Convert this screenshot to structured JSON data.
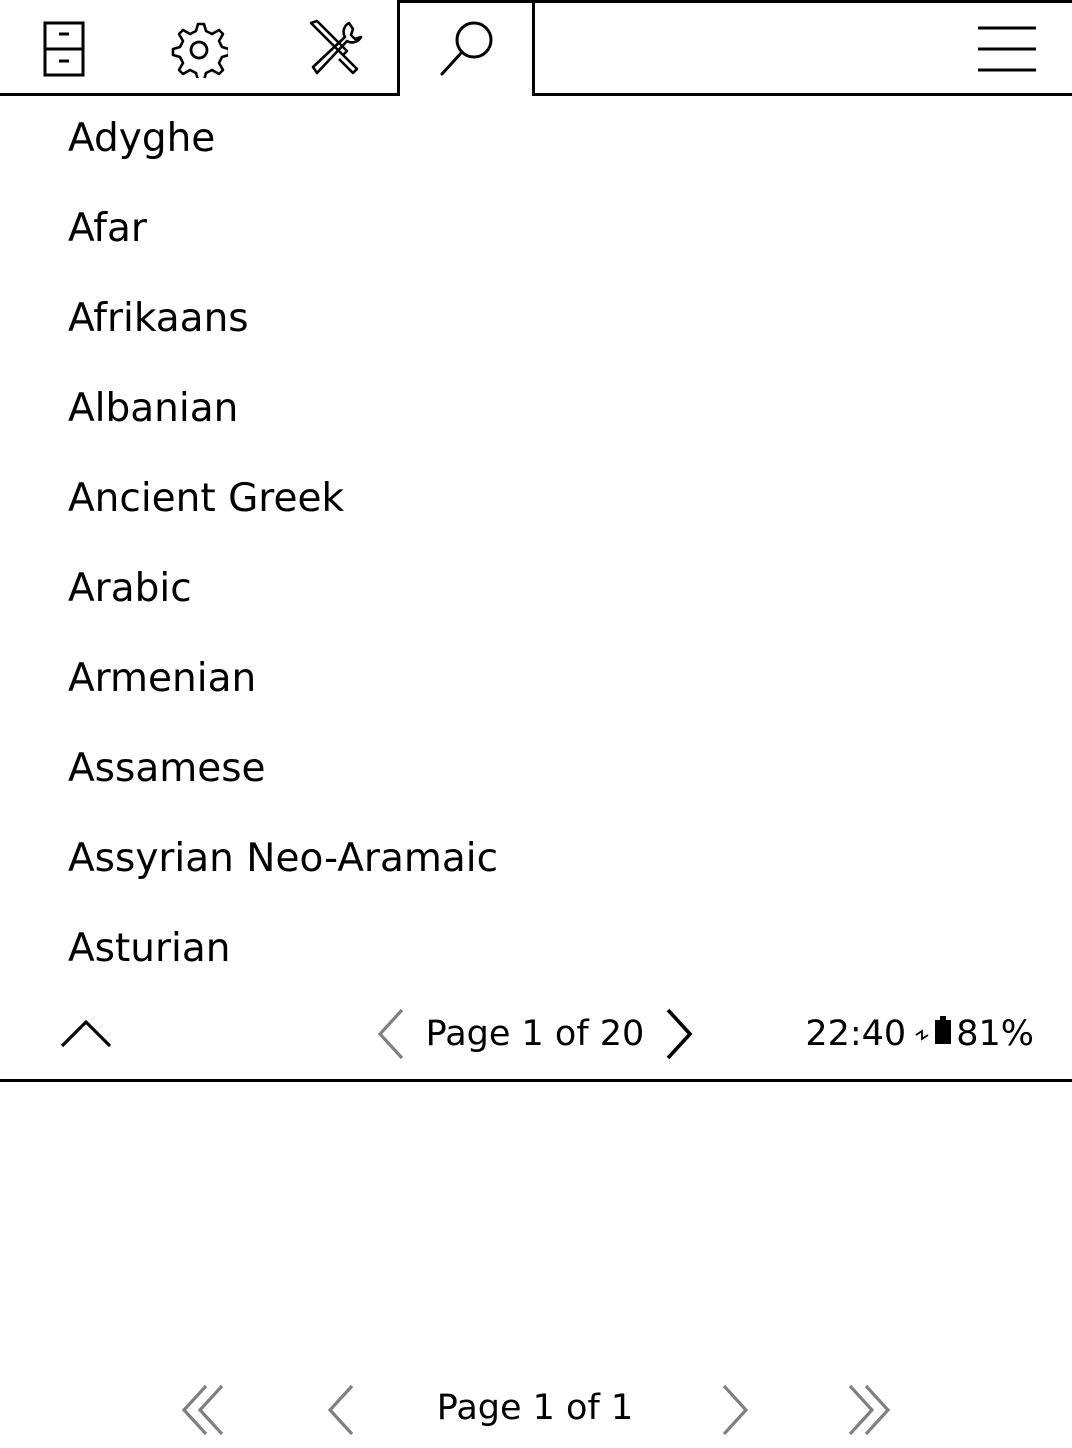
{
  "menu": {
    "tabs": [
      {
        "icon": "file-cabinet-icon"
      },
      {
        "icon": "gear-icon"
      },
      {
        "icon": "tools-icon"
      },
      {
        "icon": "search-icon",
        "active": true
      }
    ],
    "hamburger_icon": "hamburger-menu-icon"
  },
  "languages": [
    "Adyghe",
    "Afar",
    "Afrikaans",
    "Albanian",
    "Ancient Greek",
    "Arabic",
    "Armenian",
    "Assamese",
    "Assyrian Neo-Aramaic",
    "Asturian"
  ],
  "list_footer": {
    "page_label": "Page 1 of 20",
    "clock": "22:40",
    "battery_percent": "81%",
    "charging": true
  },
  "bottom_nav": {
    "page_label": "Page 1 of 1"
  },
  "colors": {
    "foreground": "#000000",
    "background": "#ffffff",
    "disabled": "#808080"
  }
}
